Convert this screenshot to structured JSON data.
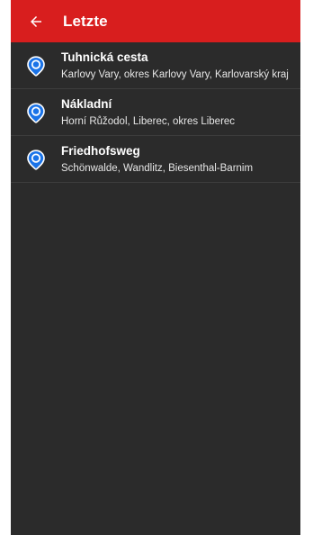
{
  "colors": {
    "appbar": "#d81e1e",
    "background": "#2b2b2b",
    "pin_fill": "#1a73e8",
    "divider": "#3d3d3d"
  },
  "header": {
    "back_icon": "arrow-left-icon",
    "title": "Letzte"
  },
  "recent": [
    {
      "icon": "location-pin-icon",
      "title": "Tuhnická cesta",
      "subtitle": "Karlovy Vary, okres Karlovy Vary, Karlovarský kraj"
    },
    {
      "icon": "location-pin-icon",
      "title": "Nákladní",
      "subtitle": "Horní Růžodol, Liberec, okres Liberec"
    },
    {
      "icon": "location-pin-icon",
      "title": "Friedhofsweg",
      "subtitle": "Schönwalde, Wandlitz, Biesenthal-Barnim"
    }
  ]
}
